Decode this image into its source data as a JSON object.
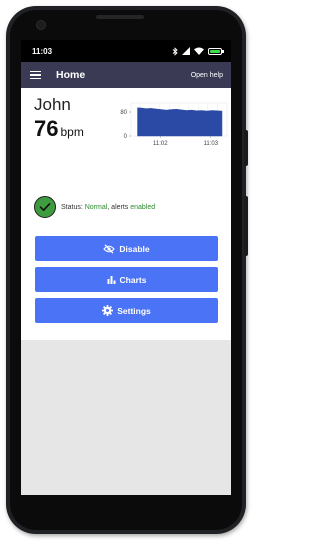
{
  "statusbar": {
    "time": "11:03"
  },
  "appbar": {
    "title": "Home",
    "help_label": "Open help"
  },
  "patient": {
    "name": "John",
    "bpm": "76",
    "bpm_unit": "bpm"
  },
  "status": {
    "prefix": "Status: ",
    "state": "Normal",
    "middle": ", alerts ",
    "alerts": "enabled",
    "color": "#2e8b2e"
  },
  "buttons": {
    "disable": {
      "label": "Disable",
      "icon": "eye-slash-icon"
    },
    "charts": {
      "label": "Charts",
      "icon": "bar-chart-icon"
    },
    "settings": {
      "label": "Settings",
      "icon": "gear-icon"
    }
  },
  "chart_data": {
    "type": "area",
    "color": "#2b4aa6",
    "ylim": [
      0,
      110
    ],
    "yticks": [
      {
        "value": 80,
        "label": "80"
      },
      {
        "value": 0,
        "label": "0"
      }
    ],
    "xticks": [
      {
        "x": 0.58,
        "label": "11:02"
      },
      {
        "x": 1.58,
        "label": "11:03"
      }
    ],
    "xlim": [
      0,
      1.9
    ],
    "x": [
      0.13,
      0.2,
      0.3,
      0.4,
      0.5,
      0.6,
      0.7,
      0.8,
      0.9,
      1.0,
      1.1,
      1.2,
      1.3,
      1.4,
      1.5,
      1.6,
      1.7,
      1.8
    ],
    "values": [
      94,
      93,
      91,
      92,
      90,
      88,
      86,
      88,
      89,
      87,
      85,
      86,
      84,
      85,
      83,
      85,
      84,
      83
    ]
  }
}
